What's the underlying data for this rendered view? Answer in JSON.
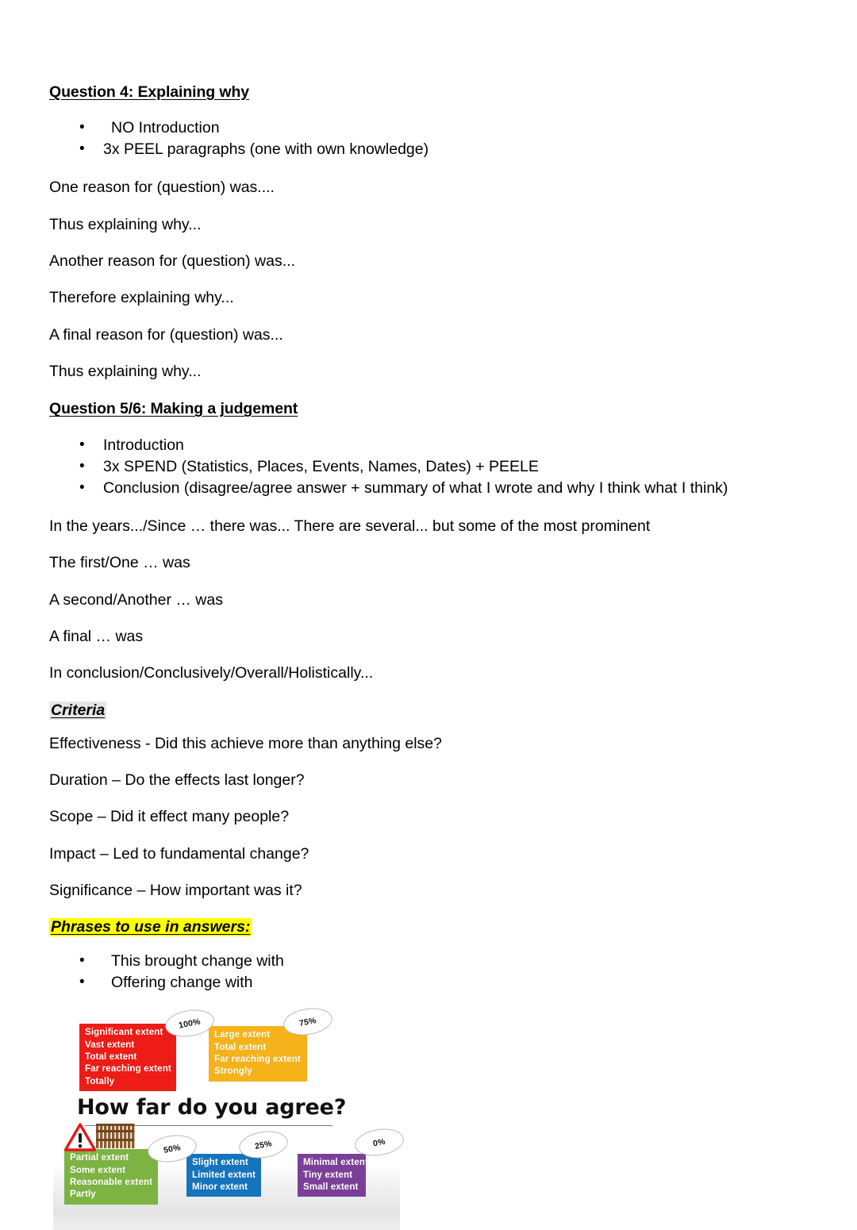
{
  "document": {
    "sections": [
      {
        "id": "question4",
        "heading": "Question 4: Explaining why",
        "bullets": [
          "NO Introduction",
          "3x PEEL paragraphs (one with own knowledge)"
        ],
        "lines": [
          "One reason for (question) was....",
          "Thus explaining why...",
          "Another reason for (question) was...",
          "Therefore explaining why...",
          "A final reason for (question) was...",
          "Thus explaining why..."
        ]
      },
      {
        "id": "question56",
        "heading": "Question 5/6: Making a judgement",
        "bullets": [
          "Introduction",
          "3x SPEND (Statistics, Places, Events, Names, Dates) + PEELE",
          "Conclusion (disagree/agree answer + summary of what I wrote and why I think what I think)"
        ],
        "lines": [
          "In the years.../Since … there was... There are several... but some of the most prominent",
          "The first/One … was",
          "A second/Another … was",
          "A final … was",
          "In conclusion/Conclusively/Overall/Holistically..."
        ]
      },
      {
        "id": "criteria",
        "heading": "Criteria",
        "highlight_color": "#e6e6e6",
        "lines": [
          "Effectiveness - Did this achieve more than anything else?",
          "Duration – Do the effects last longer?",
          "Scope – Did it effect many people?",
          "Impact – Led to fundamental change?",
          "Significance – How important was it?"
        ]
      },
      {
        "id": "phrases",
        "heading": "Phrases to use in answers:",
        "highlight_color": "#ffff00",
        "bullets": [
          "This brought change with",
          "Offering change with"
        ]
      }
    ]
  },
  "diagram": {
    "title": "How far do you agree?",
    "boxes": [
      {
        "id": "red",
        "percent": "100%",
        "color": "#ED1C16",
        "terms": [
          "Significant extent",
          "Vast extent",
          "Total extent",
          "Far reaching extent",
          "Totally"
        ]
      },
      {
        "id": "orange",
        "percent": "75%",
        "color": "#F5B319",
        "terms": [
          "Large extent",
          "Total extent",
          "Far reaching extent",
          "Strongly"
        ]
      },
      {
        "id": "green",
        "percent": "50%",
        "color": "#7CB342",
        "terms": [
          "Partial extent",
          "Some extent",
          "Reasonable extent",
          "Partly"
        ]
      },
      {
        "id": "blue",
        "percent": "25%",
        "color": "#1574BD",
        "terms": [
          "Slight extent",
          "Limited extent",
          "Minor extent"
        ]
      },
      {
        "id": "purple",
        "percent": "0%",
        "color": "#7B3F98",
        "terms": [
          "Minimal extent",
          "Tiny extent",
          "Small extent"
        ]
      }
    ],
    "icons": [
      "warning-triangle-icon",
      "fence-icon"
    ]
  }
}
